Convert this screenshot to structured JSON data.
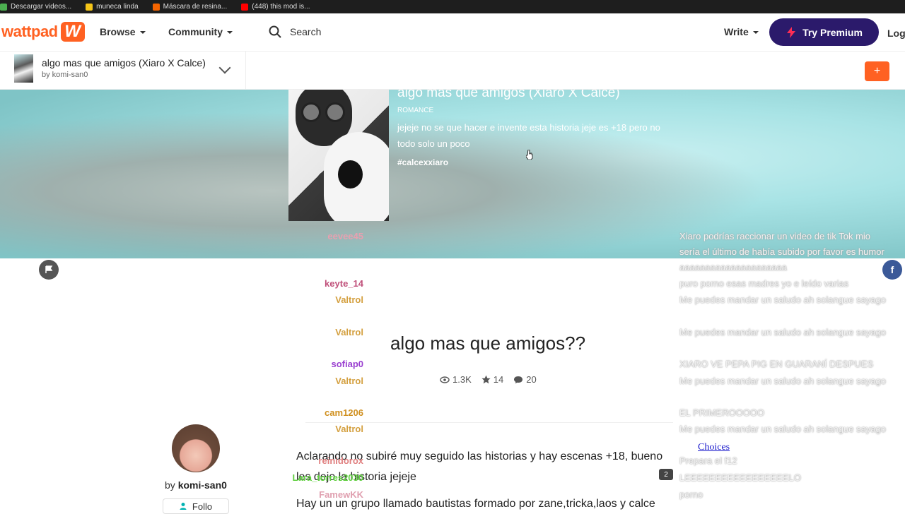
{
  "bookmarks": [
    {
      "label": "Descargar videos...",
      "color": "#4caf50"
    },
    {
      "label": "muneca linda",
      "color": "#f5c518"
    },
    {
      "label": "Máscara de resina...",
      "color": "#f56400"
    },
    {
      "label": "(448) this mod is...",
      "color": "#ff0000"
    }
  ],
  "nav": {
    "logo_text": "wattpad",
    "logo_mark": "W",
    "browse": "Browse",
    "community": "Community",
    "search": "Search",
    "write": "Write",
    "premium": "Try Premium",
    "login": "Log"
  },
  "storybar": {
    "title": "algo mas que amigos (Xiaro X Calce)",
    "author": "by komi-san0",
    "plus": "+"
  },
  "banner": {
    "title": "algo mas que amigos (Xiaro X Calce)",
    "genre": "ROMANCE",
    "description": "jejeje no se que hacer e invente esta historia jeje es +18 pero no todo solo un poco",
    "tag": "#calcexxiaro"
  },
  "chapter": {
    "title": "algo mas que amigos??",
    "views": "1.3K",
    "votes": "14",
    "comments": "20",
    "by_label": "by",
    "author": "komi-san0",
    "follow": "Follo",
    "paragraphs": [
      "Aclarando no subiré muy seguido las historias y hay escenas +18, bueno les dejo la historia jejeje",
      "Hay un un grupo llamado bautistas formado por zane,tricka,laos y calce"
    ]
  },
  "chat": [
    {
      "name": "eevee45",
      "color": "#e8a0b0",
      "text": "Xiaro podrías raccionar un video de tik Tok mio sería el último de había subido por favor es humor aaaaaaaaaaaaaaaaaaaaa"
    },
    {
      "name": "keyte_14",
      "color": "#c0507a",
      "text": "puro porno esas madres yo e leído varias"
    },
    {
      "name": "Valtrol",
      "color": "#d4a040",
      "text": "Me puedes mandar un saludo ah solangue sayago"
    },
    {
      "name": "Valtrol",
      "color": "#d4a040",
      "text": "Me puedes mandar un saludo ah solangue sayago"
    },
    {
      "name": "sofiap0",
      "color": "#9a40d0",
      "text": "XIARO VE PEPA PIG EN GUARANÍ DESPUES"
    },
    {
      "name": "Valtrol",
      "color": "#d4a040",
      "text": "Me puedes mandar un saludo ah solangue sayago"
    },
    {
      "name": "cam1206",
      "color": "#d09020",
      "text": "EL PRIMEROOOOO"
    },
    {
      "name": "Valtrol",
      "color": "#d4a040",
      "text": "Me puedes mandar un saludo ah solangue sayago"
    },
    {
      "name": "reinidorox",
      "color": "#e08080",
      "text": "Prepara el f12"
    },
    {
      "name": "Lara_torres2030",
      "color": "#60d040",
      "text": "LEEEEEEEEEEEEEEEEELO"
    },
    {
      "name": "FamewKK",
      "color": "#e0a0b0",
      "text": "porno"
    }
  ],
  "overlay": {
    "choices": "Choices",
    "badge": "2"
  }
}
